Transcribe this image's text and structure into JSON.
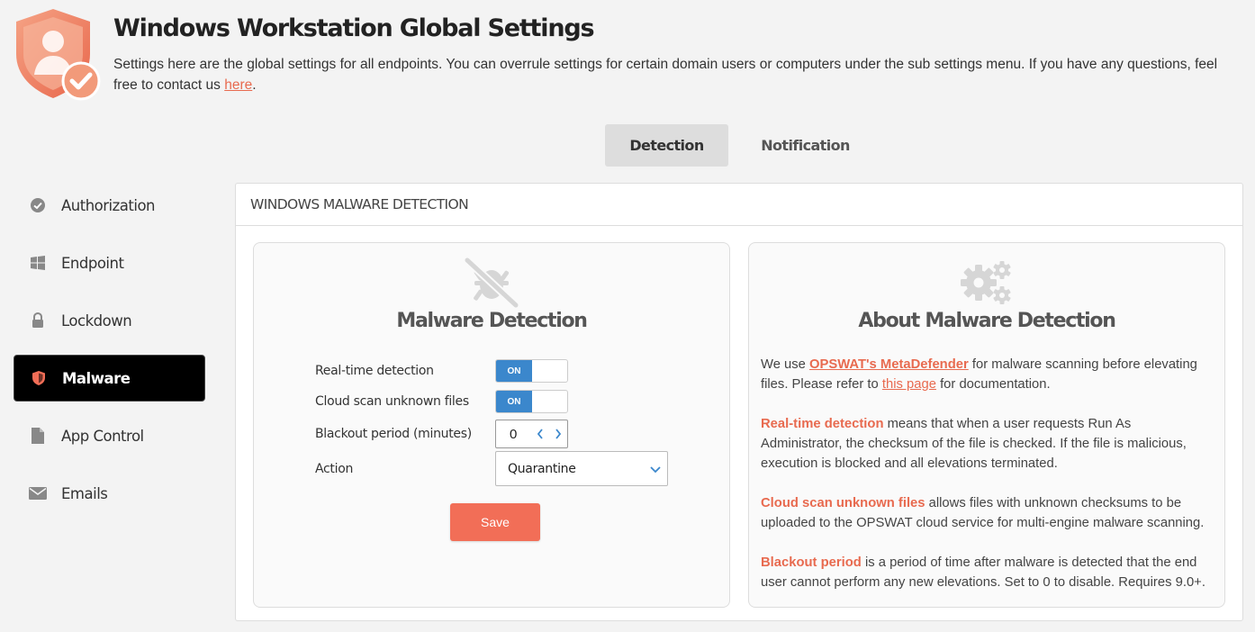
{
  "header": {
    "title": "Windows Workstation Global Settings",
    "description": "Settings here are the global settings for all endpoints. You can overrule settings for certain domain users or computers under the sub settings menu. If you have any questions, feel free to contact us ",
    "link_text": "here",
    "period": "."
  },
  "tabs": [
    {
      "label": "Detection",
      "active": true
    },
    {
      "label": "Notification",
      "active": false
    }
  ],
  "sidebar": {
    "items": [
      {
        "label": "Authorization",
        "icon": "check-circle-icon"
      },
      {
        "label": "Endpoint",
        "icon": "windows-icon"
      },
      {
        "label": "Lockdown",
        "icon": "lock-icon"
      },
      {
        "label": "Malware",
        "icon": "shield-icon",
        "active": true
      },
      {
        "label": "App Control",
        "icon": "file-icon"
      },
      {
        "label": "Emails",
        "icon": "envelope-icon"
      }
    ]
  },
  "panel": {
    "header": "WINDOWS MALWARE DETECTION",
    "left_card": {
      "title": "Malware Detection",
      "icon": "bug-slash-icon",
      "fields": {
        "realtime_label": "Real-time detection",
        "realtime_value": "ON",
        "cloud_label": "Cloud scan unknown files",
        "cloud_value": "ON",
        "blackout_label": "Blackout period (minutes)",
        "blackout_value": "0",
        "action_label": "Action",
        "action_value": "Quarantine"
      },
      "save_label": "Save"
    },
    "right_card": {
      "title": "About Malware Detection",
      "icon": "gears-icon",
      "p1_pre": "We use ",
      "p1_link": "OPSWAT's MetaDefender",
      "p1_mid": " for malware scanning before elevating files. Please refer to ",
      "p1_link2": "this page",
      "p1_post": " for documentation.",
      "p2_hl": "Real-time detection",
      "p2_text": " means that when a user requests Run As Administrator, the checksum of the file is checked. If the file is malicious, execution is blocked and all elevations terminated.",
      "p3_hl": "Cloud scan unknown files",
      "p3_text": " allows files with unknown checksums to be uploaded to the OPSWAT cloud service for multi-engine malware scanning.",
      "p4_hl": "Blackout period",
      "p4_text": " is a period of time after malware is detected that the end user cannot perform any new elevations. Set to 0 to disable. Requires 9.0+."
    }
  },
  "colors": {
    "accent": "#f26e57",
    "toggle_on": "#3b87cc",
    "sidebar_active": "#000000"
  }
}
